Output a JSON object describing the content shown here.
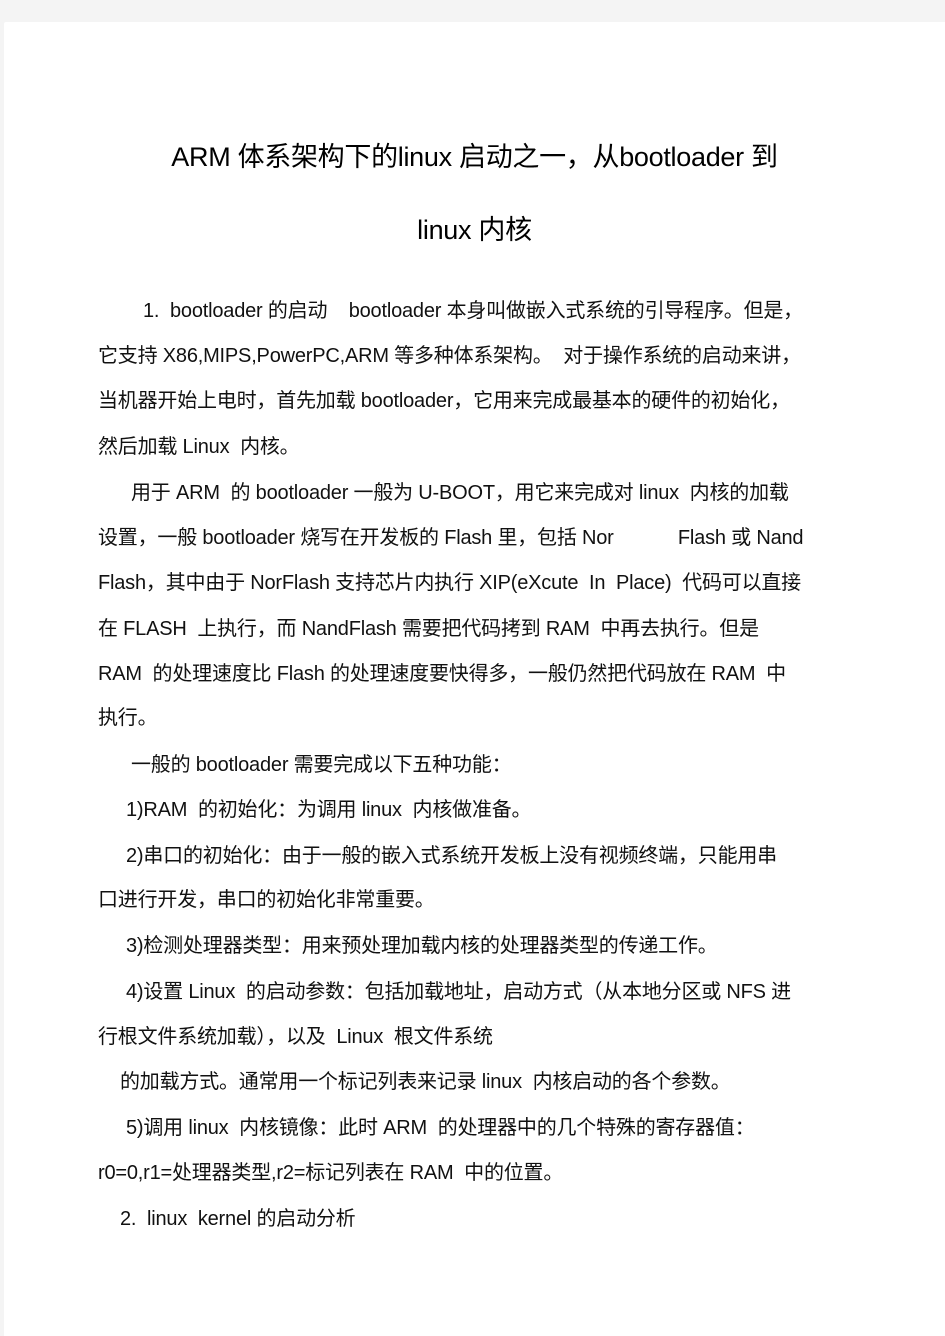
{
  "document": {
    "title_line1": "ARM 体系架构下的linux 启动之一，从bootloader 到",
    "title_line2": "linux 内核",
    "lines": [
      "1.  bootloader 的启动    bootloader 本身叫做嵌入式系统的引导程序。但是，",
      "它支持 X86,MIPS,PowerPC,ARM 等多种体系架构。  对于操作系统的启动来讲，",
      "当机器开始上电时，首先加载 bootloader，它用来完成最基本的硬件的初始化，",
      "然后加载 Linux  内核。",
      "用于 ARM  的 bootloader 一般为 U-BOOT，用它来完成对 linux  内核的加载",
      "设置，一般 bootloader 烧写在开发板的 Flash 里，包括 Nor            Flash 或 Nand",
      "Flash，其中由于 NorFlash 支持芯片内执行 XIP(eXcute  In  Place)  代码可以直接",
      "在 FLASH  上执行，而 NandFlash 需要把代码拷到 RAM  中再去执行。但是",
      "RAM  的处理速度比 Flash 的处理速度要快得多，一般仍然把代码放在 RAM  中",
      "执行。",
      "一般的 bootloader 需要完成以下五种功能：",
      "1)RAM  的初始化：为调用 linux  内核做准备。",
      "2)串口的初始化：由于一般的嵌入式系统开发板上没有视频终端，只能用串",
      "口进行开发，串口的初始化非常重要。",
      "3)检测处理器类型：用来预处理加载内核的处理器类型的传递工作。",
      "4)设置 Linux  的启动参数：包括加载地址，启动方式（从本地分区或 NFS 进",
      "行根文件系统加载），以及  Linux  根文件系统",
      "的加载方式。通常用一个标记列表来记录 linux  内核启动的各个参数。",
      "5)调用 linux  内核镜像：此时 ARM  的处理器中的几个特殊的寄存器值：",
      "r0=0,r1=处理器类型,r2=标记列表在 RAM  中的位置。",
      "2.  linux  kernel 的启动分析"
    ]
  }
}
